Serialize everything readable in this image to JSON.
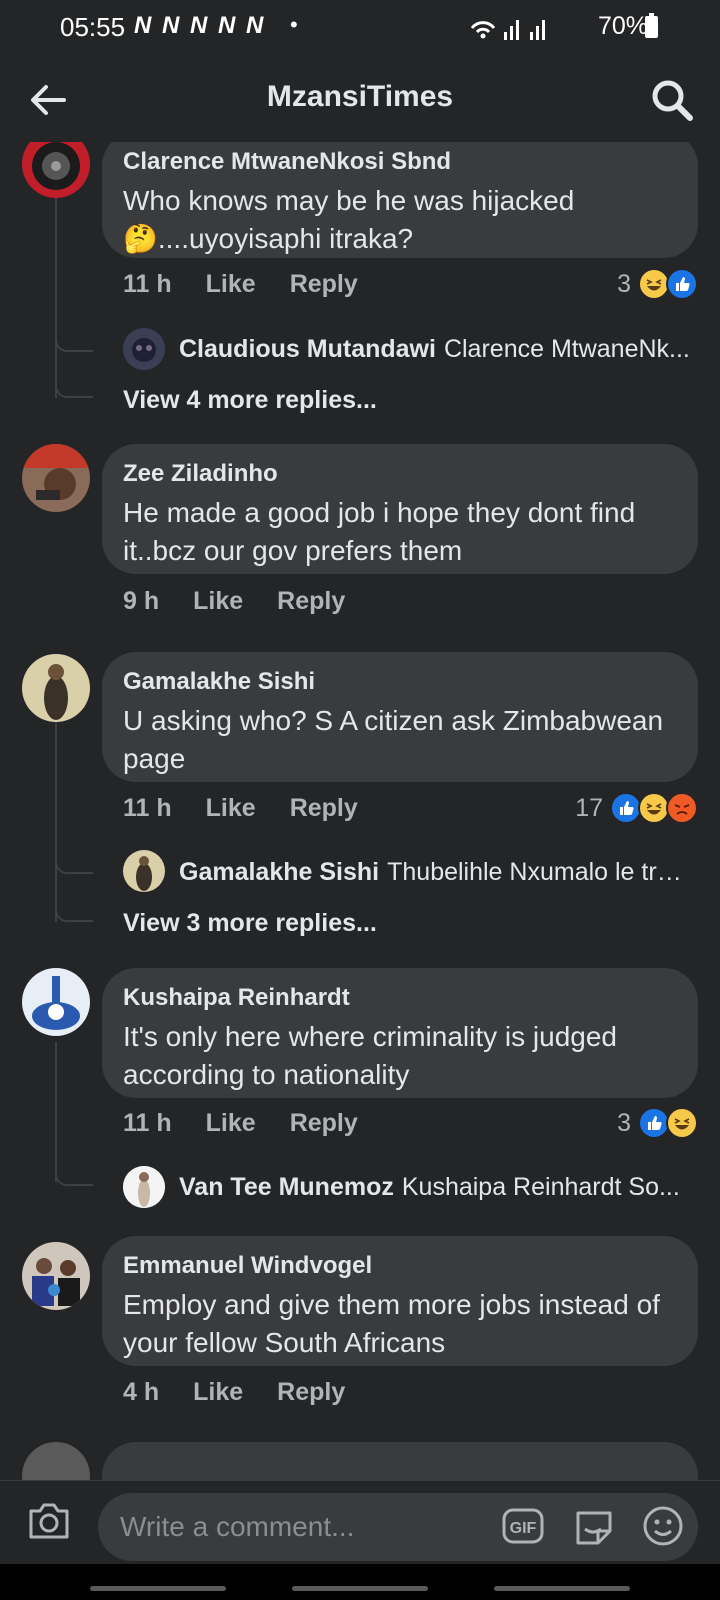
{
  "status_bar": {
    "time": "05:55",
    "notification_icons": "N N N N N",
    "dot": "•",
    "battery": "70%"
  },
  "header": {
    "title": "MzansiTimes"
  },
  "comments": [
    {
      "author": "Clarence MtwaneNkosi Sbnd",
      "text": "Who knows may be he was hijacked 🤔....uyoyisaphi itraka?",
      "time": "11 h",
      "like_label": "Like",
      "reply_label": "Reply",
      "reaction_count": "3",
      "reactions": [
        "haha",
        "like"
      ],
      "reply_preview": {
        "name": "Claudious Mutandawi",
        "text": "Clarence MtwaneNk..."
      },
      "view_more": "View 4 more replies..."
    },
    {
      "author": "Zee Ziladinho",
      "text": "He made a good job i hope they dont find it..bcz our gov prefers them",
      "time": "9 h",
      "like_label": "Like",
      "reply_label": "Reply"
    },
    {
      "author": "Gamalakhe Sishi",
      "text": "U asking who? S A citizen ask Zimbabwean page",
      "time": "11 h",
      "like_label": "Like",
      "reply_label": "Reply",
      "reaction_count": "17",
      "reactions": [
        "like",
        "haha",
        "angry"
      ],
      "reply_preview": {
        "name": "Gamalakhe Sishi",
        "text": "Thubelihle Nxumalo le tru..."
      },
      "view_more": "View 3 more replies..."
    },
    {
      "author": "Kushaipa Reinhardt",
      "text": "It's only here where criminality is judged according to nationality",
      "time": "11 h",
      "like_label": "Like",
      "reply_label": "Reply",
      "reaction_count": "3",
      "reactions": [
        "like",
        "haha"
      ],
      "reply_preview": {
        "name": "Van Tee Munemoz",
        "text": "Kushaipa Reinhardt  So..."
      }
    },
    {
      "author": "Emmanuel Windvogel",
      "text": "Employ and give them more jobs instead of your fellow South Africans",
      "time": "4 h",
      "like_label": "Like",
      "reply_label": "Reply"
    }
  ],
  "composer": {
    "placeholder": "Write a comment...",
    "gif_label": "GIF"
  },
  "colors": {
    "background": "#242526",
    "bubble": "#3a3b3c",
    "like_blue": "#1b74e4",
    "haha_yellow": "#f7c94a",
    "angry_orange": "#f05a24"
  }
}
